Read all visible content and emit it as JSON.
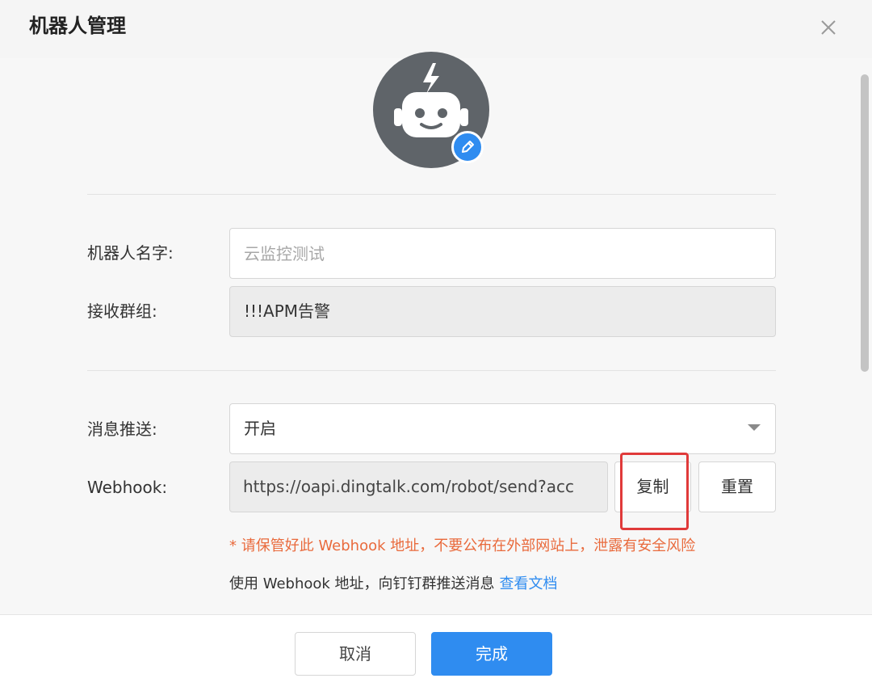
{
  "dialog": {
    "title": "机器人管理"
  },
  "form": {
    "name": {
      "label": "机器人名字:",
      "placeholder": "云监控测试"
    },
    "group": {
      "label": "接收群组:",
      "value": "!!!APM告警"
    },
    "push": {
      "label": "消息推送:",
      "value": "开启"
    },
    "webhook": {
      "label": "Webhook:",
      "value": "https://oapi.dingtalk.com/robot/send?acc",
      "copy_label": "复制",
      "reset_label": "重置"
    },
    "warning": "* 请保管好此 Webhook 地址，不要公布在外部网站上，泄露有安全风险",
    "hint": "使用 Webhook 地址，向钉钉群推送消息",
    "docs_link": "查看文档"
  },
  "footer": {
    "cancel_label": "取消",
    "done_label": "完成"
  },
  "colors": {
    "primary": "#2f8cf0",
    "warning": "#e96a3c",
    "highlight": "#e03a3a",
    "avatar_bg": "#5f6469"
  }
}
